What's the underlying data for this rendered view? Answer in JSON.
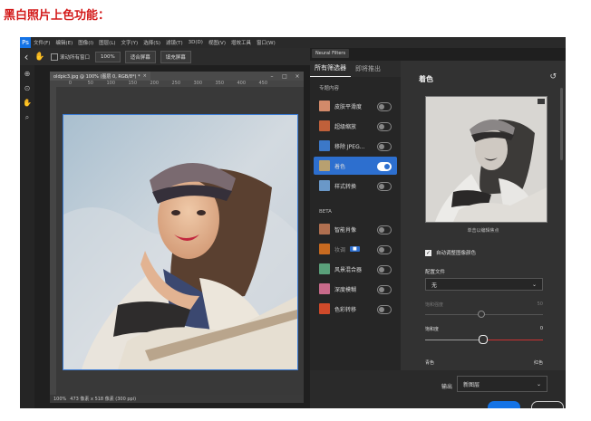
{
  "caption": "黑白照片上色功能：",
  "menubar": {
    "app_icon": "Ps",
    "items": [
      "文件(F)",
      "编辑(E)",
      "图像(I)",
      "图层(L)",
      "文字(Y)",
      "选择(S)",
      "滤镜(T)",
      "3D(D)",
      "视图(V)",
      "增效工具",
      "窗口(W)"
    ]
  },
  "options_bar": {
    "scroll_all": "滚动所有窗口",
    "zoom": "100%",
    "fit_screen": "适合屏幕",
    "fill_screen": "填充屏幕"
  },
  "document": {
    "tab_title": "oldpic3.jpg @ 100% (图层 0, RGB/8*) *",
    "ruler": [
      "0",
      "50",
      "100",
      "150",
      "200",
      "250",
      "300",
      "350",
      "400",
      "450"
    ],
    "status": "100%",
    "status_size": "473 像素 x 518 像素 (300 ppi)"
  },
  "neural_filters": {
    "panel_label": "Neural Filters",
    "tabs": [
      "所有筛选器",
      "即将推出"
    ],
    "featured_section": "专题内容",
    "featured": [
      {
        "name": "皮肤平滑度",
        "on": false,
        "thumb": "#d28a6a"
      },
      {
        "name": "超级缩放",
        "on": false,
        "thumb": "#c0603a"
      },
      {
        "name": "移除 JPEG...",
        "on": false,
        "thumb": "#3c78c8"
      },
      {
        "name": "着色",
        "on": true,
        "thumb": "#b8a070"
      },
      {
        "name": "样式转换",
        "on": false,
        "thumb": "#6a98c8"
      }
    ],
    "beta_section": "BETA",
    "beta": [
      {
        "name": "智能肖像",
        "on": false,
        "thumb": "#b07050",
        "badge": ""
      },
      {
        "name": "妆调",
        "on": false,
        "thumb": "#c86a20",
        "badge": "■"
      },
      {
        "name": "风景混合器",
        "on": false,
        "thumb": "#5aa07a",
        "badge": ""
      },
      {
        "name": "深度模糊",
        "on": false,
        "thumb": "#c86a8a",
        "badge": ""
      },
      {
        "name": "色彩转移",
        "on": false,
        "thumb": "#d04a2a",
        "badge": ""
      }
    ],
    "detail": {
      "title": "着色",
      "preview_hint": "单击以编辑焦点",
      "auto_color_label": "自动调整图像颜色",
      "profile_label": "配置文件",
      "profile_value": "无",
      "saturation_disabled_label": "饱和强度",
      "saturation_disabled_value": "50",
      "saturation_label": "饱和度",
      "saturation_value": "0",
      "bottom_left": "青色",
      "bottom_right": "红色"
    },
    "output_label": "输出",
    "output_value": "新图层"
  }
}
